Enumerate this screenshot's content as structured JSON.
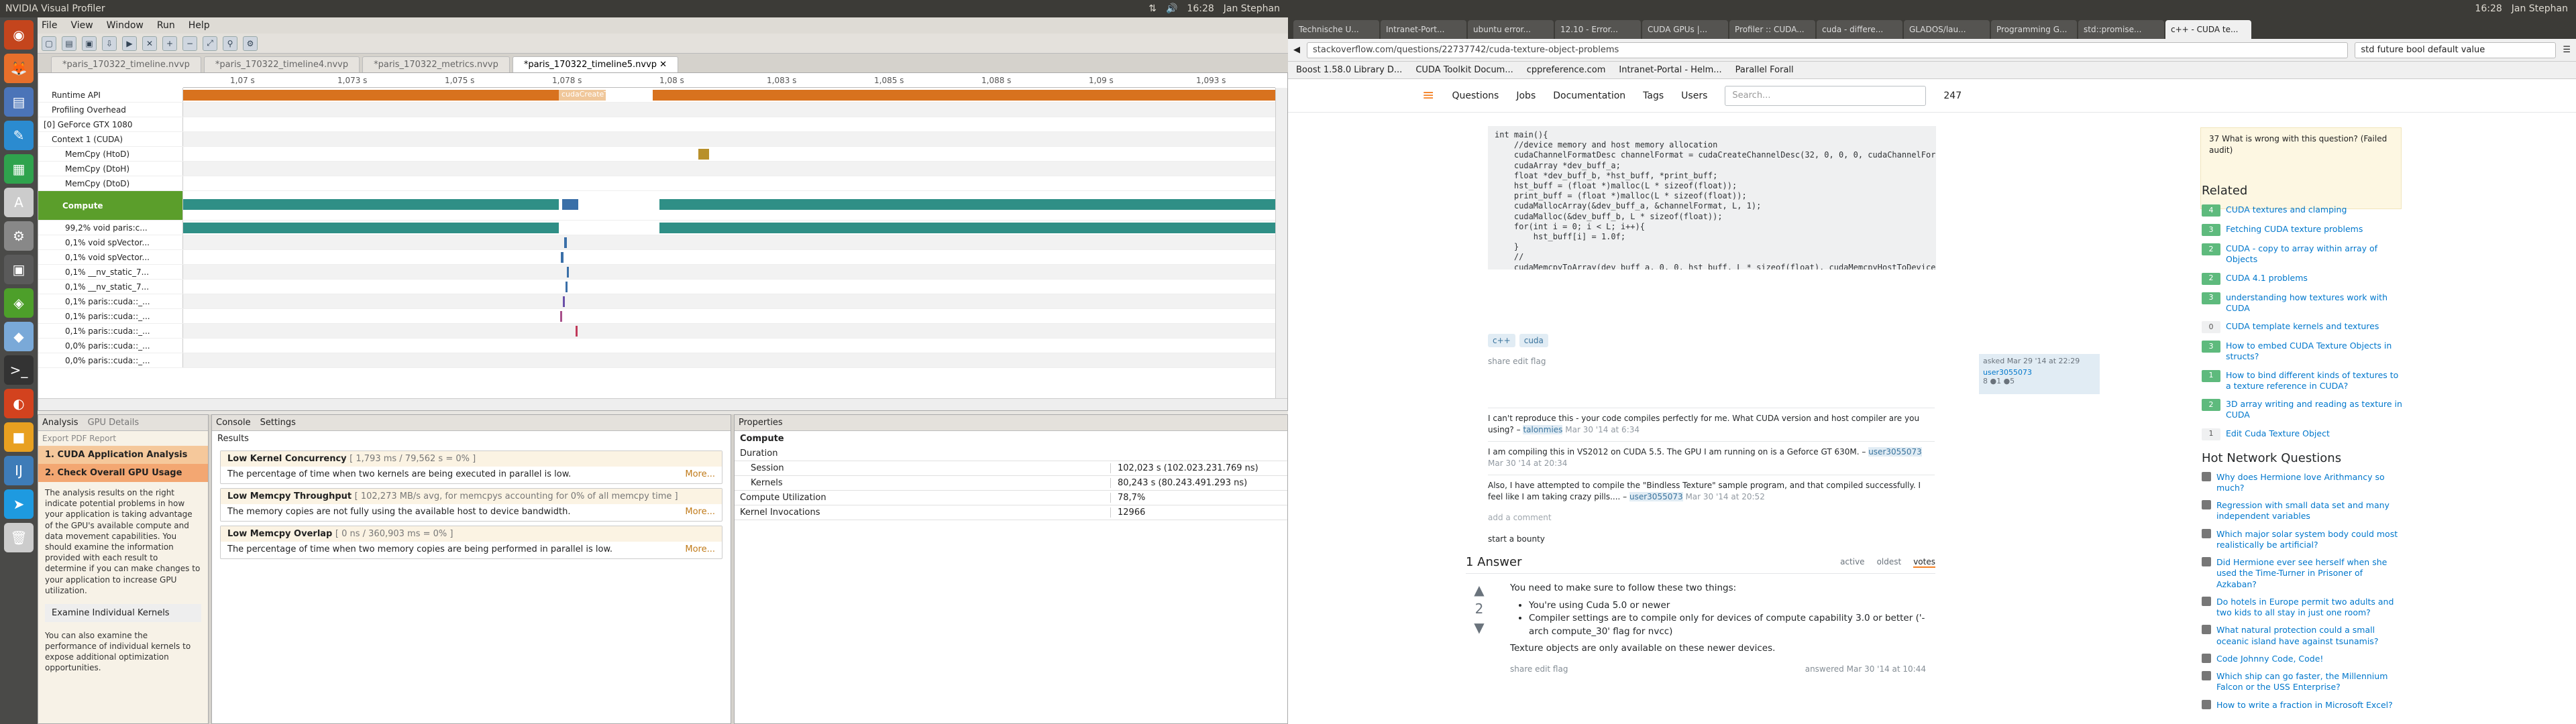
{
  "left": {
    "topbar_title": "NVIDIA Visual Profiler",
    "tray": {
      "clock": "16:28",
      "user": "Jan Stephan"
    },
    "menu": [
      "File",
      "View",
      "Window",
      "Run",
      "Help"
    ],
    "tabs": [
      "*paris_170322_timeline.nvvp",
      "*paris_170322_timeline4.nvvp",
      "*paris_170322_metrics.nvvp",
      "*paris_170322_timeline5.nvvp"
    ],
    "ruler_ticks": [
      "1,07 s",
      "1,073 s",
      "1,075 s",
      "1,078 s",
      "1,08 s",
      "1,083 s",
      "1,085 s",
      "1,088 s",
      "1,09 s",
      "1,093 s"
    ],
    "rows": [
      {
        "label": "Runtime API"
      },
      {
        "label": "Profiling Overhead"
      },
      {
        "label": "[0] GeForce GTX 1080"
      },
      {
        "label": "Context 1 (CUDA)"
      },
      {
        "label": "MemCpy (HtoD)"
      },
      {
        "label": "MemCpy (DtoH)"
      },
      {
        "label": "MemCpy (DtoD)"
      },
      {
        "label": "Compute"
      },
      {
        "label": "99,2% void paris:c..."
      },
      {
        "label": "0,1% void spVector..."
      },
      {
        "label": "0,1% void spVector..."
      },
      {
        "label": "0,1% __nv_static_7..."
      },
      {
        "label": "0,1% __nv_static_7..."
      },
      {
        "label": "0,1% paris::cuda::_..."
      },
      {
        "label": "0,1% paris::cuda::_..."
      },
      {
        "label": "0,1% paris::cuda::_..."
      },
      {
        "label": "0,0% paris::cuda::_..."
      },
      {
        "label": "0,0% paris::cuda::_..."
      }
    ],
    "runtime_label": "cudaCreateTe...",
    "analysis_tabs": [
      "Analysis",
      "GPU Details",
      "Console",
      "Settings"
    ],
    "export_label": "Export PDF Report",
    "steps": [
      "1. CUDA Application Analysis",
      "2. Check Overall GPU Usage"
    ],
    "guide_text": "The analysis results on the right indicate potential problems in how your application is taking advantage of the GPU's available compute and data movement capabilities. You should examine the information provided with each result to determine if you can make changes to your application to increase GPU utilization.",
    "examine_label": "Examine Individual Kernels",
    "guide_text2": "You can also examine the performance of individual kernels to expose additional optimization opportunities.",
    "results_title": "Results",
    "results": [
      {
        "title": "Low Kernel Concurrency",
        "meta": "[ 1,793 ms / 79,562 s = 0% ]",
        "desc": "The percentage of time when two kernels are being executed in parallel is low.",
        "more": "More..."
      },
      {
        "title": "Low Memcpy Throughput",
        "meta": "[ 102,273 MB/s avg, for memcpys accounting for 0% of all memcpy time ]",
        "desc": "The memory copies are not fully using the available host to device bandwidth.",
        "more": "More..."
      },
      {
        "title": "Low Memcpy Overlap",
        "meta": "[ 0 ns / 360,903 ms = 0% ]",
        "desc": "The percentage of time when two memory copies are being performed in parallel is low.",
        "more": "More..."
      }
    ],
    "properties_title": "Properties",
    "prop_section": "Compute",
    "props": [
      {
        "k": "Duration",
        "v": ""
      },
      {
        "k": "Session",
        "v": "102,023 s (102.023.231.769 ns)"
      },
      {
        "k": "Kernels",
        "v": "80,243 s (80.243.491.293 ns)"
      },
      {
        "k": "Compute Utilization",
        "v": "78,7%"
      },
      {
        "k": "Kernel Invocations",
        "v": "12966"
      }
    ]
  },
  "right": {
    "tabs": [
      "Technische U...",
      "Intranet-Port...",
      "ubuntu error...",
      "12.10 - Error...",
      "CUDA GPUs |...",
      "Profiler :: CUDA...",
      "cuda - differe...",
      "GLADOS/lau...",
      "Programming G...",
      "std::promise...",
      "c++ - CUDA te..."
    ],
    "url": "stackoverflow.com/questions/22737742/cuda-texture-object-problems",
    "search": "std future bool default value",
    "bookmarks": [
      "Boost 1.58.0 Library D...",
      "CUDA Toolkit Docum...",
      "cppreference.com",
      "Intranet-Portal - Helm...",
      "Parallel Forall"
    ],
    "so_nav": [
      "Questions",
      "Jobs",
      "Documentation",
      "Tags",
      "Users"
    ],
    "so_search": "Search...",
    "rep": "247",
    "code": "int main(){\n    //device memory and host memory allocation\n    cudaChannelFormatDesc channelFormat = cudaCreateChannelDesc(32, 0, 0, 0, cudaChannelFormatKindFloat);\n    cudaArray *dev_buff_a;\n    float *dev_buff_b, *hst_buff, *print_buff;\n    hst_buff = (float *)malloc(L * sizeof(float));\n    print_buff = (float *)malloc(L * sizeof(float));\n    cudaMallocArray(&dev_buff_a, &channelFormat, L, 1);\n    cudaMalloc(&dev_buff_b, L * sizeof(float));\n    for(int i = 0; i < L; i++){\n        hst_buff[i] = 1.0f;\n    }\n    //\n    cudaMemcpyToArray(dev_buff_a, 0, 0, hst_buff, L * sizeof(float), cudaMemcpyHostToDevice);\n\n    //creating the texture object",
    "tags": [
      "c++",
      "cuda"
    ],
    "post_menu": "share  edit  flag",
    "asked": "asked Mar 29 '14 at 22:29",
    "asker": "user3055073",
    "asker_rep": "8 ●1 ●5",
    "comments": [
      {
        "text": "I can't reproduce this - your code compiles perfectly for me. What CUDA version and host compiler are you using? –",
        "user": "talonmies",
        "date": "Mar 30 '14 at 6:34"
      },
      {
        "text": "I am compiling this in VS2012 on CUDA 5.5. The GPU I am running on is a Geforce GT 630M. –",
        "user": "user3055073",
        "date": "Mar 30 '14 at 20:34"
      },
      {
        "text": "Also, I have attempted to compile the \"Bindless Texture\" sample program, and that compiled successfully. I feel like I am taking crazy pills.... –",
        "user": "user3055073",
        "date": "Mar 30 '14 at 20:52"
      }
    ],
    "add_comment": "add a comment",
    "bounty": "start a bounty",
    "answers_title": "1 Answer",
    "sort": [
      "active",
      "oldest",
      "votes"
    ],
    "vote": "2",
    "answer_intro": "You need to make sure to follow these two things:",
    "answer_items": [
      "You're using Cuda 5.0 or newer",
      "Compiler settings are to compile only for devices of compute capability 3.0 or better ('-arch compute_30' flag for nvcc)"
    ],
    "answer_end": "Texture objects are only available on these newer devices.",
    "answered": "answered Mar 30 '14 at 10:44",
    "notice_items": [
      "37  What is wrong with this question? (Failed audit)"
    ],
    "related_title": "Related",
    "related": [
      {
        "score": "4",
        "title": "CUDA textures and clamping"
      },
      {
        "score": "3",
        "title": "Fetching CUDA texture problems"
      },
      {
        "score": "2",
        "title": "CUDA - copy to array within array of Objects"
      },
      {
        "score": "2",
        "title": "CUDA 4.1 problems"
      },
      {
        "score": "3",
        "title": "understanding how textures work with CUDA"
      },
      {
        "score": "0",
        "title": "CUDA template kernels and textures"
      },
      {
        "score": "3",
        "title": "How to embed CUDA Texture Objects in structs?"
      },
      {
        "score": "1",
        "title": "How to bind different kinds of textures to a texture reference in CUDA?"
      },
      {
        "score": "2",
        "title": "3D array writing and reading as texture in CUDA"
      },
      {
        "score": "1",
        "title": "Edit Cuda Texture Object"
      }
    ],
    "hot_title": "Hot Network Questions",
    "hot": [
      "Why does Hermione love Arithmancy so much?",
      "Regression with small data set and many independent variables",
      "Which major solar system body could most realistically be artificial?",
      "Did Hermione ever see herself when she used the Time-Turner in Prisoner of Azkaban?",
      "Do hotels in Europe permit two adults and two kids to all stay in just one room?",
      "What natural protection could a small oceanic island have against tsunamis?",
      "Code Johnny Code, Code!",
      "Which ship can go faster, the Millennium Falcon or the USS Enterprise?",
      "How to write a fraction in Microsoft Excel?"
    ]
  }
}
